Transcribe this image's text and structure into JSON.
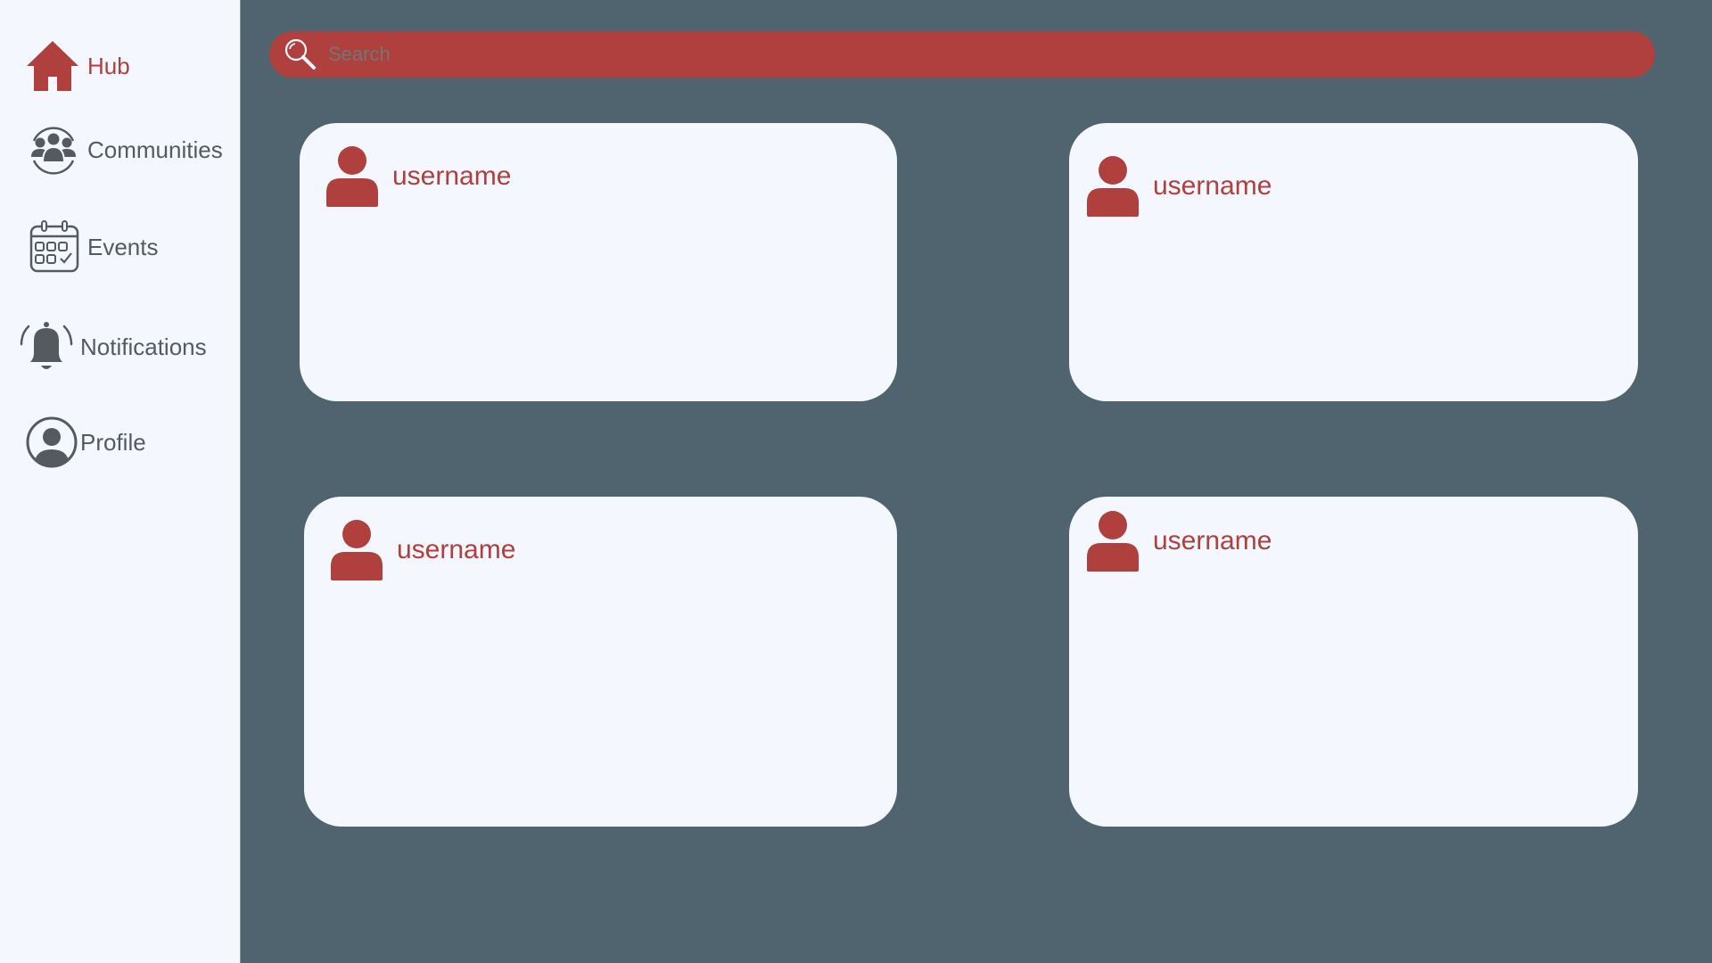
{
  "sidebar": {
    "items": [
      {
        "label": "Hub",
        "icon": "home-icon",
        "active": true
      },
      {
        "label": "Communities",
        "icon": "communities-icon",
        "active": false
      },
      {
        "label": "Events",
        "icon": "calendar-icon",
        "active": false
      },
      {
        "label": "Notifications",
        "icon": "bell-icon",
        "active": false
      },
      {
        "label": "Profile",
        "icon": "profile-icon",
        "active": false
      }
    ]
  },
  "search": {
    "placeholder": "Search",
    "icon": "search-icon"
  },
  "posts": [
    {
      "username": "username",
      "avatar_icon": "user-icon"
    },
    {
      "username": "username",
      "avatar_icon": "user-icon"
    },
    {
      "username": "username",
      "avatar_icon": "user-icon"
    },
    {
      "username": "username",
      "avatar_icon": "user-icon"
    }
  ],
  "colors": {
    "accent": "#AF403D",
    "background": "#506470",
    "panel": "#F4F8FE",
    "text_muted": "#555A5F"
  }
}
